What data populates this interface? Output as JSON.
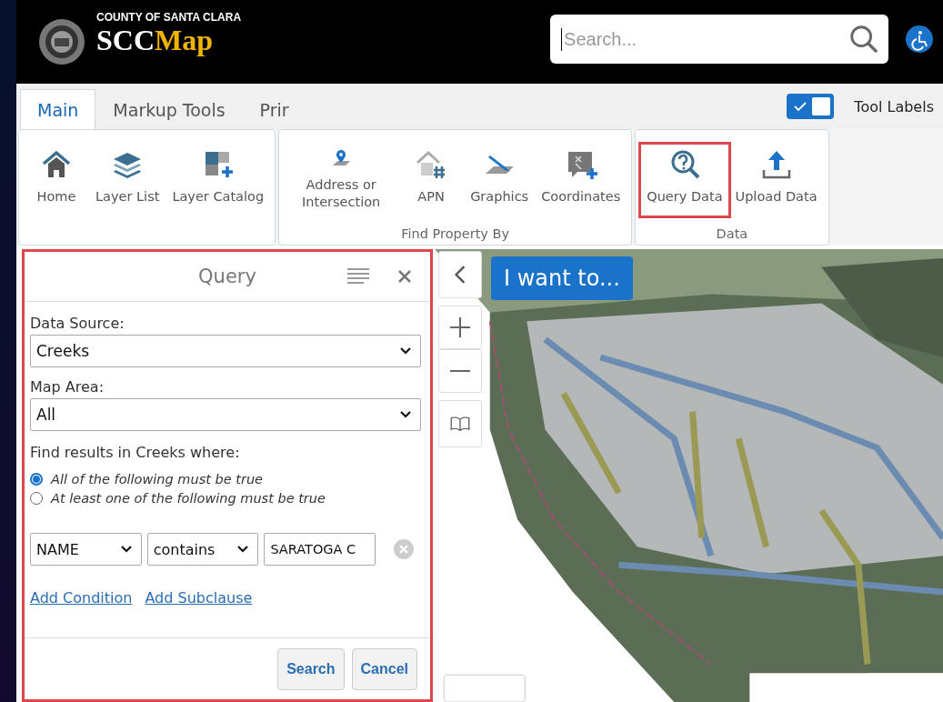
{
  "header": {
    "county": "COUNTY OF SANTA CLARA",
    "app_name_1": "SCC",
    "app_name_2": "Map",
    "search": {
      "placeholder": "Search..."
    }
  },
  "tabs": [
    {
      "label": "Main",
      "selected": true
    },
    {
      "label": "Markup Tools",
      "selected": false
    },
    {
      "label": "Prir",
      "selected": false
    }
  ],
  "tool_labels": {
    "label": "Tool Labels",
    "on": true
  },
  "ribbon": [
    {
      "items": [
        {
          "label": "Home",
          "kind": "home",
          "highlighted": false
        },
        {
          "label": "Layer List",
          "kind": "layers",
          "highlighted": false
        },
        {
          "label": "Layer Catalog",
          "kind": "catalog",
          "highlighted": false
        }
      ]
    },
    {
      "caption": "Find Property By",
      "items": [
        {
          "label": "Address or Intersection",
          "kind": "pin",
          "highlighted": false
        },
        {
          "label": "APN",
          "kind": "apn",
          "highlighted": false
        },
        {
          "label": "Graphics",
          "kind": "graphics",
          "highlighted": false
        },
        {
          "label": "Coordinates",
          "kind": "coordinates",
          "highlighted": false
        }
      ]
    },
    {
      "caption": "Data",
      "items": [
        {
          "label": "Query Data",
          "kind": "query",
          "highlighted": true
        },
        {
          "label": "Upload Data",
          "kind": "upload",
          "highlighted": false
        }
      ]
    }
  ],
  "query_panel": {
    "title": "Query",
    "highlighted": true,
    "data_source": {
      "label": "Data Source:",
      "value": "Creeks"
    },
    "map_area": {
      "label": "Map Area:",
      "value": "All"
    },
    "find_label": "Find results in Creeks where:",
    "match_options": [
      {
        "label": "All of the following must be true",
        "selected": true
      },
      {
        "label": "At least one of the following must be true",
        "selected": false
      }
    ],
    "condition": {
      "field": "NAME",
      "operator": "contains",
      "value": "SARATOGA C"
    },
    "links": [
      "Add Condition",
      "Add Subclause"
    ],
    "buttons": [
      "Search",
      "Cancel"
    ]
  },
  "map": {
    "button": "I want to..."
  }
}
